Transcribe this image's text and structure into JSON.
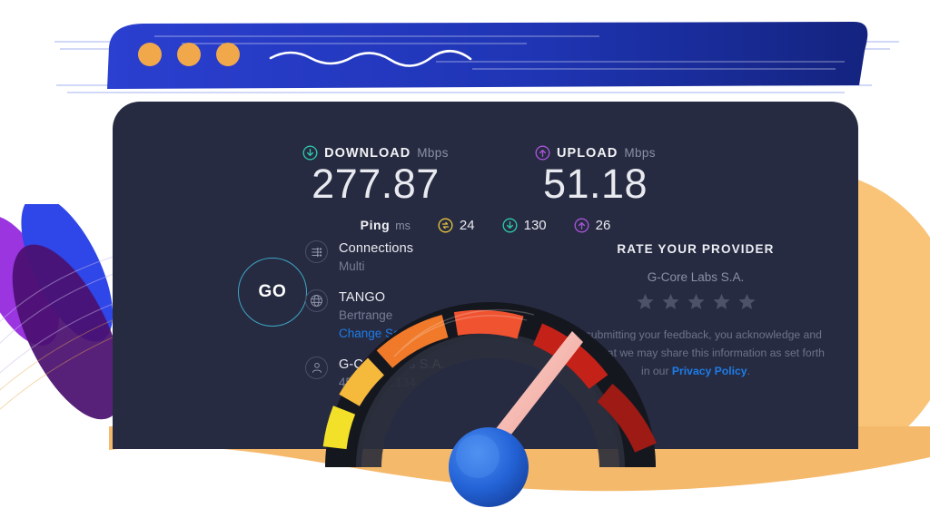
{
  "panel": {
    "background_color": "#262b41"
  },
  "results": {
    "download": {
      "label": "DOWNLOAD",
      "unit": "Mbps",
      "value": "277.87",
      "icon": "circle-arrow-down-icon",
      "color": "#2ec7a8"
    },
    "upload": {
      "label": "UPLOAD",
      "unit": "Mbps",
      "value": "51.18",
      "icon": "circle-arrow-up-icon",
      "color": "#a855d8"
    },
    "ping": {
      "label": "Ping",
      "unit": "ms",
      "idle": {
        "value": "24",
        "icon": "circle-arrows-idle-icon",
        "color": "#e8c33c"
      },
      "download": {
        "value": "130",
        "icon": "circle-arrow-down-icon",
        "color": "#2ec7a8"
      },
      "upload": {
        "value": "26",
        "icon": "circle-arrow-up-icon",
        "color": "#a855d8"
      }
    }
  },
  "go_button": {
    "label": "GO",
    "ring_color": "#3ea6c4"
  },
  "connection": {
    "rows": [
      {
        "icon": "connections-icon",
        "title": "Connections",
        "subtitle": "Multi",
        "link": null
      },
      {
        "icon": "globe-icon",
        "title": "TANGO",
        "subtitle": "Bertrange",
        "link": "Change Server"
      },
      {
        "icon": "person-icon",
        "title": "G-Core Labs S.A.",
        "subtitle": "45.140.xx.134",
        "link": null
      }
    ]
  },
  "rate_provider": {
    "title": "RATE YOUR PROVIDER",
    "provider": "G-Core Labs S.A.",
    "stars_total": 5,
    "stars_filled": 0,
    "star_color": "#4d5268",
    "disclaimer_before": "By submitting your feedback, you acknowledge and agree that we may share this information as set forth in our ",
    "disclaimer_link": "Privacy Policy",
    "disclaimer_after": "."
  },
  "decor": {
    "brush_banner": {
      "name": "blue-brush-banner",
      "color": "#1f35b5",
      "dots": 3,
      "dot_color": "#f0a84a",
      "squiggle_color": "#ffffff"
    },
    "petals": {
      "name": "purple-blue-petals",
      "colors": [
        "#8b2fd6",
        "#2f46e8",
        "#4a1070"
      ]
    },
    "orange_blob": {
      "name": "orange-blob",
      "color": "#f8c071"
    },
    "orange_wave": {
      "name": "orange-wave",
      "color": "#f5b96b"
    },
    "gauge": {
      "name": "speedometer-illustration",
      "segment_colors": [
        "#f2e029",
        "#f5b93c",
        "#f07a2a",
        "#ef5330",
        "#c42119",
        "#9e1a14"
      ],
      "needle_color": "#f5a8a0",
      "hub_color": "#1f63d4"
    }
  }
}
